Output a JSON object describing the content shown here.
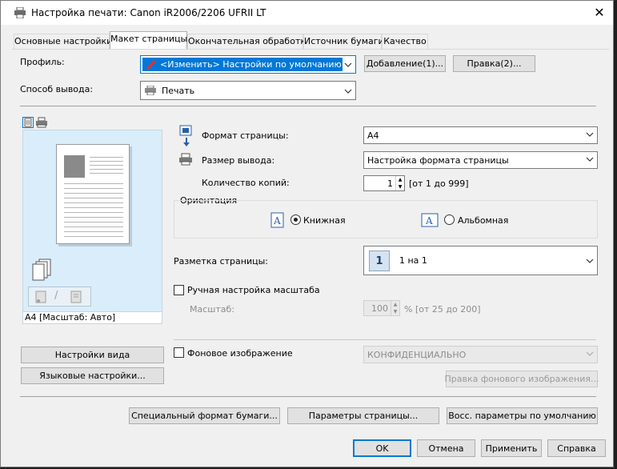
{
  "window": {
    "title": "Настройка печати: Canon iR2006/2206 UFRII LT"
  },
  "tabs": [
    "Основные настройки",
    "Макет страницы",
    "Окончательная обработка",
    "Источник бумаги",
    "Качество"
  ],
  "profile": {
    "label": "Профиль:",
    "value": "<Изменить> Настройки по умолчанию",
    "add_button": "Добавление(1)...",
    "edit_button": "Правка(2)..."
  },
  "output": {
    "label": "Способ вывода:",
    "value": "Печать"
  },
  "preview": {
    "caption": "A4 [Масштаб: Авто]"
  },
  "page_size": {
    "label": "Формат страницы:",
    "value": "A4"
  },
  "output_size": {
    "label": "Размер вывода:",
    "value": "Настройка формата страницы"
  },
  "copies": {
    "label": "Количество копий:",
    "value": "1",
    "range": "[от 1 до 999]"
  },
  "orientation": {
    "label": "Ориентация",
    "portrait": "Книжная",
    "landscape": "Альбомная",
    "selected": "portrait"
  },
  "layout": {
    "label": "Разметка страницы:",
    "value": "1 на 1",
    "icon_digit": "1"
  },
  "manual_scale": {
    "label": "Ручная настройка масштаба",
    "checked": false
  },
  "scale": {
    "label": "Масштаб:",
    "value": "100",
    "unit_range": "% [от 25 до 200]"
  },
  "left_buttons": {
    "view_settings": "Настройки вида",
    "language_settings": "Языковые настройки..."
  },
  "watermark": {
    "label": "Фоновое изображение",
    "checked": false,
    "value": "КОНФИДЕНЦИАЛЬНО",
    "edit_button": "Правка фонового изображения..."
  },
  "bottom_row": {
    "custom_paper": "Специальный формат бумаги...",
    "page_options": "Параметры страницы...",
    "restore_defaults": "Восс. параметры по умолчанию"
  },
  "dialog_buttons": {
    "ok": "OK",
    "cancel": "Отмена",
    "apply": "Применить",
    "help": "Справка"
  },
  "colors": {
    "accent": "#0078d7",
    "preview_bg": "#d9eefa",
    "highlight_text": "#ffffff"
  }
}
